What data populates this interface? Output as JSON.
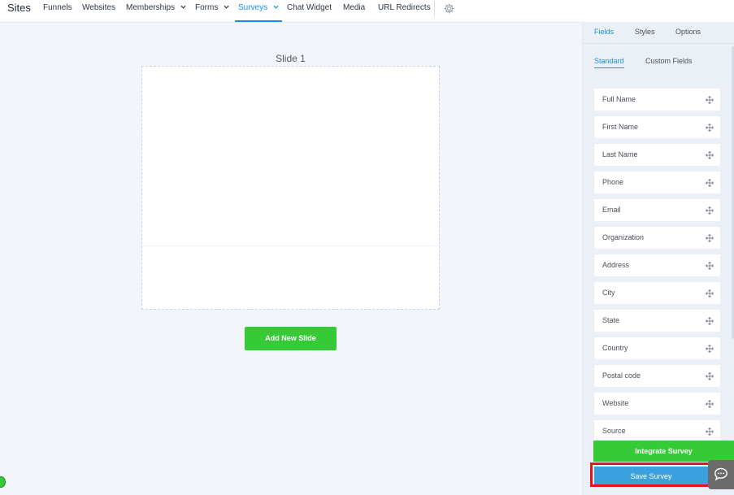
{
  "topnav": {
    "brand": "Sites",
    "items": [
      {
        "label": "Funnels"
      },
      {
        "label": "Websites"
      },
      {
        "label": "Memberships"
      },
      {
        "label": "Forms"
      },
      {
        "label": "Surveys"
      },
      {
        "label": "Chat Widget"
      },
      {
        "label": "Media"
      },
      {
        "label": "URL Redirects"
      }
    ],
    "active_item": "Surveys",
    "settings_icon": "gear-icon"
  },
  "canvas": {
    "slide_title": "Slide 1",
    "add_slide_label": "Add New Slide"
  },
  "panel": {
    "tabs": [
      {
        "label": "Fields"
      },
      {
        "label": "Styles"
      },
      {
        "label": "Options"
      }
    ],
    "active_tab": "Fields",
    "subtabs": [
      {
        "label": "Standard"
      },
      {
        "label": "Custom Fields"
      }
    ],
    "active_subtab": "Standard",
    "fields": [
      {
        "label": "Full Name"
      },
      {
        "label": "First Name"
      },
      {
        "label": "Last Name"
      },
      {
        "label": "Phone"
      },
      {
        "label": "Email"
      },
      {
        "label": "Organization"
      },
      {
        "label": "Address"
      },
      {
        "label": "City"
      },
      {
        "label": "State"
      },
      {
        "label": "Country"
      },
      {
        "label": "Postal code"
      },
      {
        "label": "Website"
      },
      {
        "label": "Source"
      }
    ],
    "integrate_label": "Integrate Survey",
    "save_label": "Save Survey"
  },
  "colors": {
    "accent": "#188bf6",
    "green": "#37ca37",
    "save_blue": "#3aa0e0",
    "highlight_red": "#e0181b"
  }
}
